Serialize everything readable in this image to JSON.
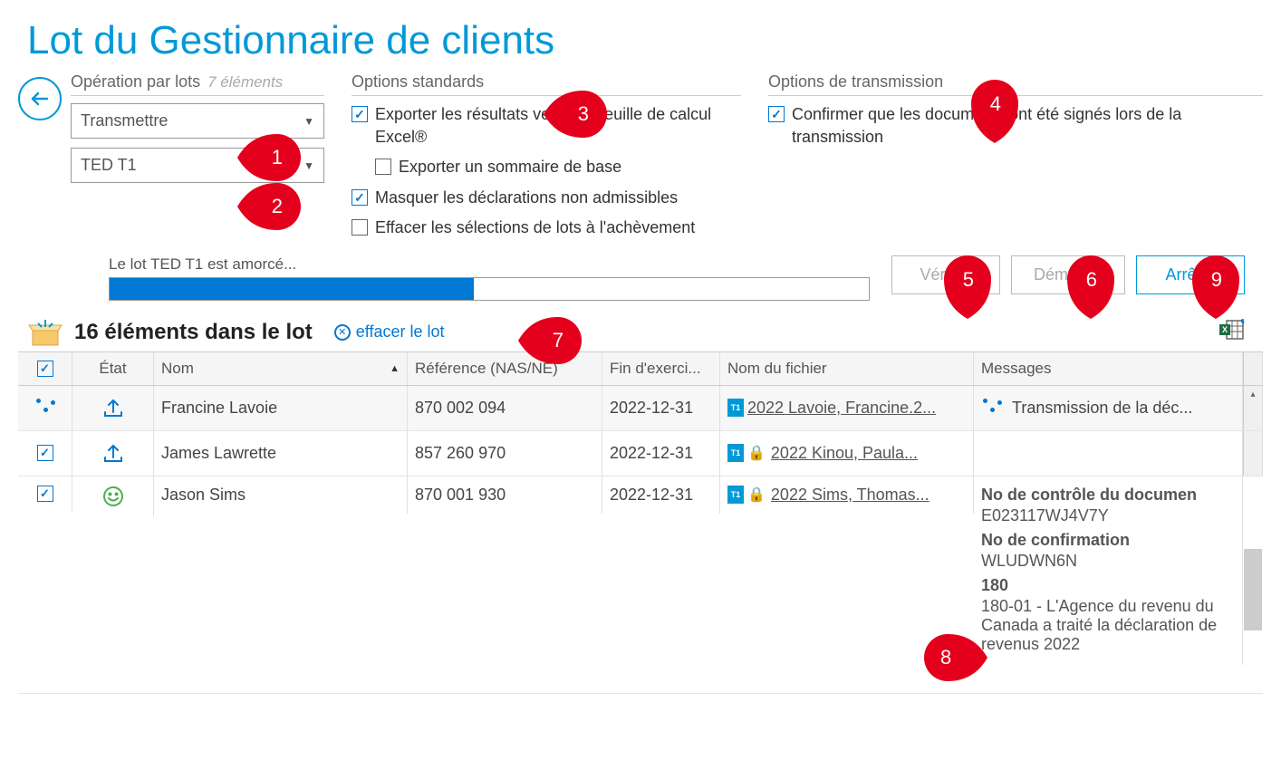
{
  "title": "Lot du Gestionnaire de clients",
  "operation": {
    "label": "Opération par lots",
    "count": "7 éléments",
    "dropdown1": "Transmettre",
    "dropdown2": "TED T1"
  },
  "standard_options": {
    "label": "Options standards",
    "opt1": "Exporter les résultats vers une feuille de calcul Excel®",
    "opt2": "Exporter un sommaire de base",
    "opt3": "Masquer les déclarations non admissibles",
    "opt4": "Effacer les sélections de lots à l'achèvement"
  },
  "transmission_options": {
    "label": "Options de transmission",
    "opt1": "Confirmer que les documents ont été signés lors de la transmission"
  },
  "progress": {
    "label": "Le lot TED T1 est amorcé..."
  },
  "buttons": {
    "verify": "Vérifier",
    "start": "Démarrer",
    "stop": "Arrêter"
  },
  "batch": {
    "title": "16 éléments dans le lot",
    "clear": "effacer le lot"
  },
  "columns": {
    "status": "État",
    "name": "Nom",
    "ref": "Référence (NAS/NE)",
    "date": "Fin d'exerci...",
    "file": "Nom du fichier",
    "msg": "Messages"
  },
  "rows": [
    {
      "name": "Francine Lavoie",
      "ref": "870 002 094",
      "date": "2022-12-31",
      "file": "2022 Lavoie, Francine.2...",
      "msg": "Transmission de la déc..."
    },
    {
      "name": "James Lawrette",
      "ref": "857 260 970",
      "date": "2022-12-31",
      "file": "2022 Kinou, Paula..."
    },
    {
      "name": "Jason Sims",
      "ref": "870 001 930",
      "date": "2022-12-31",
      "file": "2022 Sims, Thomas..."
    }
  ],
  "messages": {
    "dcn_label": "No de contrôle du documen",
    "dcn_value": "E023117WJ4V7Y",
    "conf_label": "No de confirmation",
    "conf_value": "WLUDWN6N",
    "code": "180",
    "body": "180-01 - L'Agence du revenu du Canada a traité la déclaration de revenus 2022"
  },
  "callouts": {
    "c1": "1",
    "c2": "2",
    "c3": "3",
    "c4": "4",
    "c5": "5",
    "c6": "6",
    "c7": "7",
    "c8": "8",
    "c9": "9"
  }
}
